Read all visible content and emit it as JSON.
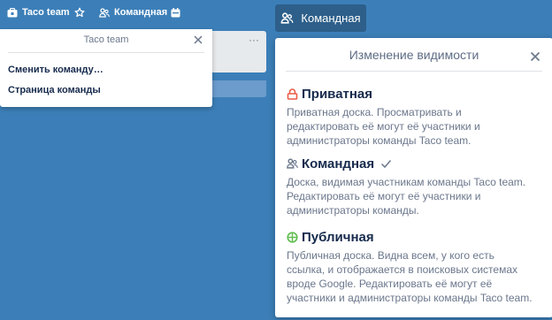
{
  "header": {
    "team_label": "Taco team",
    "star_icon": "star-icon",
    "visibility_label": "Командная",
    "calendar_icon": "calendar-icon",
    "visibility_button_label": "Командная"
  },
  "team_popover": {
    "title": "Taco team",
    "items": [
      {
        "label": "Сменить команду…"
      },
      {
        "label": "Страница команды"
      }
    ]
  },
  "visibility_popover": {
    "title": "Изменение видимости",
    "options": [
      {
        "title": "Приватная",
        "icon": "lock-icon",
        "icon_color": "#eb5a46",
        "selected": false,
        "desc_lines": [
          "Приватная доска. Просматривать и",
          "редактировать её могут её участники и",
          "администраторы команды Taco team."
        ]
      },
      {
        "title": "Командная",
        "icon": "team-icon",
        "icon_color": "#6b778c",
        "selected": true,
        "desc_lines": [
          "Доска, видимая участникам команды Taco team.",
          "Редактировать её могут её участники и",
          "администраторы команды."
        ]
      },
      {
        "title": "Публичная",
        "icon": "globe-icon",
        "icon_color": "#61bd4f",
        "selected": false,
        "desc_lines": [
          "Публичная доска. Видна всем, у кого есть",
          "ссылка, и отображается в поисковых системах",
          "вроде Google. Редактировать её могут её",
          "участники и администраторы команды Taco team."
        ]
      }
    ]
  },
  "colors": {
    "board_background": "#3c7fb8",
    "visibility_button": "#2d5f8a",
    "private": "#eb5a46",
    "public": "#61bd4f"
  }
}
